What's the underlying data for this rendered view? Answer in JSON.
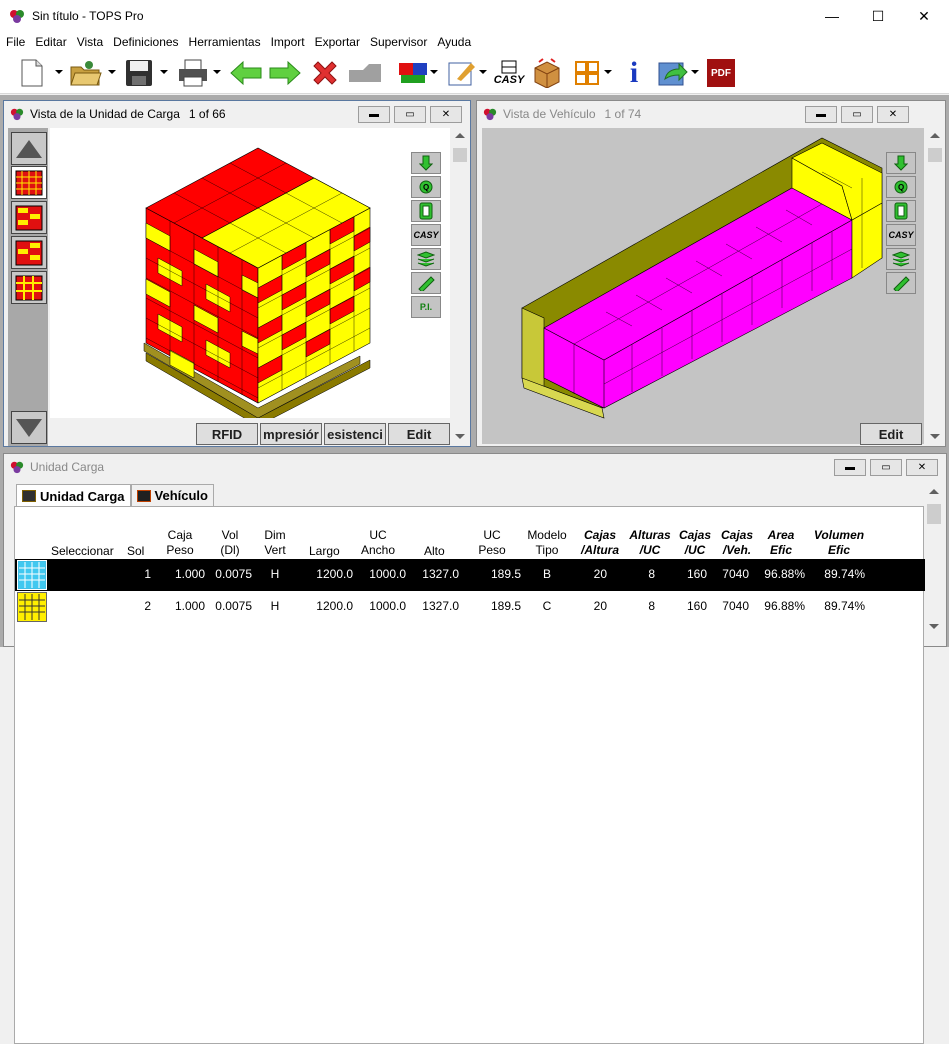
{
  "window": {
    "title": "Sin título - TOPS Pro",
    "minimize": "—",
    "maximize": "☐",
    "close": "✕"
  },
  "menu": [
    "File",
    "Editar",
    "Vista",
    "Definiciones",
    "Herramientas",
    "Import",
    "Exportar",
    "Supervisor",
    "Ayuda"
  ],
  "toolbar": {
    "casy_label": "CASY",
    "pdf_label": "PDF",
    "info_label": "i"
  },
  "load_view": {
    "title": "Vista de la Unidad de Carga",
    "page": "1 of 66",
    "right_buttons": [
      "CASY",
      "P.I."
    ],
    "bottom_buttons": [
      "RFID",
      "mpresiór",
      "esistenci",
      "Edit"
    ]
  },
  "vehicle_view": {
    "title": "Vista de Vehículo",
    "page": "1 of 74",
    "right_buttons": [
      "CASY"
    ],
    "edit_label": "Edit"
  },
  "results": {
    "title": "Unidad Carga",
    "tabs": [
      "Unidad Carga",
      "Vehículo"
    ],
    "headers": [
      {
        "l1": "",
        "l2": "Seleccionar"
      },
      {
        "l1": "",
        "l2": "Sol"
      },
      {
        "l1": "Caja",
        "l2": "Peso"
      },
      {
        "l1": "Vol",
        "l2": "(Dl)"
      },
      {
        "l1": "Dim",
        "l2": "Vert"
      },
      {
        "l1": "",
        "l2": "Largo"
      },
      {
        "l1": "UC",
        "l2": "Ancho"
      },
      {
        "l1": "",
        "l2": "Alto"
      },
      {
        "l1": "UC",
        "l2": "Peso"
      },
      {
        "l1": "Modelo",
        "l2": "Tipo"
      },
      {
        "l1": "Cajas",
        "l2": "/Altura"
      },
      {
        "l1": "Alturas",
        "l2": "/UC"
      },
      {
        "l1": "Cajas",
        "l2": "/UC"
      },
      {
        "l1": "Cajas",
        "l2": "/Veh."
      },
      {
        "l1": "Area",
        "l2": "Efic"
      },
      {
        "l1": "Volumen",
        "l2": "Efic"
      }
    ],
    "rows": [
      {
        "sol": "1",
        "caja_peso": "1.000",
        "vol": "0.0075",
        "dim": "H",
        "largo": "1200.0",
        "ancho": "1000.0",
        "alto": "1327.0",
        "uc_peso": "189.5",
        "tipo": "B",
        "cajas_altura": "20",
        "alturas_uc": "8",
        "cajas_uc": "160",
        "cajas_veh": "7040",
        "area": "96.88%",
        "vol_efic": "89.74%"
      },
      {
        "sol": "2",
        "caja_peso": "1.000",
        "vol": "0.0075",
        "dim": "H",
        "largo": "1200.0",
        "ancho": "1000.0",
        "alto": "1327.0",
        "uc_peso": "189.5",
        "tipo": "C",
        "cajas_altura": "20",
        "alturas_uc": "8",
        "cajas_uc": "160",
        "cajas_veh": "7040",
        "area": "96.88%",
        "vol_efic": "89.74%"
      }
    ]
  },
  "colors": {
    "pallet_red": "#ff0000",
    "pallet_yellow": "#ffff00",
    "vehicle_magenta": "#ff00ff",
    "vehicle_olive": "#8a8a00",
    "selected_row": "#000000"
  }
}
